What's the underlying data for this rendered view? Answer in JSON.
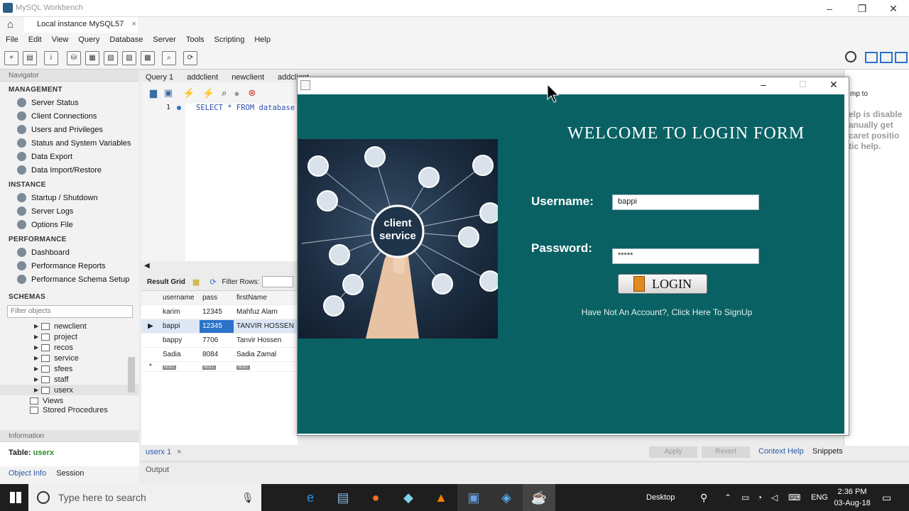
{
  "app": {
    "title": "MySQL Workbench",
    "instance_tab": "Local instance MySQL57"
  },
  "menu": [
    "File",
    "Edit",
    "View",
    "Query",
    "Database",
    "Server",
    "Tools",
    "Scripting",
    "Help"
  ],
  "navigator": {
    "header": "Navigator",
    "management": {
      "title": "MANAGEMENT",
      "items": [
        "Server Status",
        "Client Connections",
        "Users and Privileges",
        "Status and System Variables",
        "Data Export",
        "Data Import/Restore"
      ]
    },
    "instance": {
      "title": "INSTANCE",
      "items": [
        "Startup / Shutdown",
        "Server Logs",
        "Options File"
      ]
    },
    "performance": {
      "title": "PERFORMANCE",
      "items": [
        "Dashboard",
        "Performance Reports",
        "Performance Schema Setup"
      ]
    },
    "schemas": {
      "title": "SCHEMAS",
      "filter_placeholder": "Filter objects",
      "tables": [
        "newclient",
        "project",
        "recos",
        "service",
        "sfees",
        "staff",
        "userx"
      ],
      "views": "Views",
      "procs": "Stored Procedures"
    }
  },
  "info_panel": {
    "header": "Information",
    "table_label": "Table:",
    "table_name": "userx",
    "tab_object": "Object Info",
    "tab_session": "Session"
  },
  "query_tabs": [
    "Query 1",
    "addclient",
    "newclient",
    "addclient"
  ],
  "editor": {
    "line": "1",
    "sql": "SELECT * FROM database"
  },
  "result": {
    "tab": "Result Grid",
    "filter_label": "Filter Rows:",
    "columns": [
      "username",
      "pass",
      "firstName"
    ],
    "rows": [
      {
        "username": "karim",
        "pass": "12345",
        "firstName": "Mahfuz Alam"
      },
      {
        "username": "bappi",
        "pass": "12345",
        "firstName": "TANVIR HOSSEN"
      },
      {
        "username": "bappy",
        "pass": "7706",
        "firstName": "Tanvir Hossen"
      },
      {
        "username": "Sadia",
        "pass": "8084",
        "firstName": "Sadia  Zamal"
      }
    ],
    "null_label": "NULL",
    "new_row_marker": "*"
  },
  "bottom": {
    "result_tab": "userx 1",
    "apply": "Apply",
    "revert": "Revert",
    "context_help": "Context Help",
    "snippets": "Snippets",
    "output": "Output"
  },
  "right_panel": {
    "jump": "mp to",
    "help_lines": [
      "elp is disable",
      "anually get",
      "caret positio",
      "tic help."
    ]
  },
  "login": {
    "welcome": "WELCOME TO LOGIN FORM",
    "username_label": "Username:",
    "username_value": "bappi",
    "password_label": "Password:",
    "password_value": "*****",
    "login_button": "LOGIN",
    "signup_link": "Have Not An Account?, Click Here To SignUp",
    "illustration_text_1": "client",
    "illustration_text_2": "service"
  },
  "taskbar": {
    "search_placeholder": "Type here to search",
    "desktop": "Desktop",
    "lang": "ENG",
    "time": "2:36 PM",
    "date": "03-Aug-18"
  }
}
